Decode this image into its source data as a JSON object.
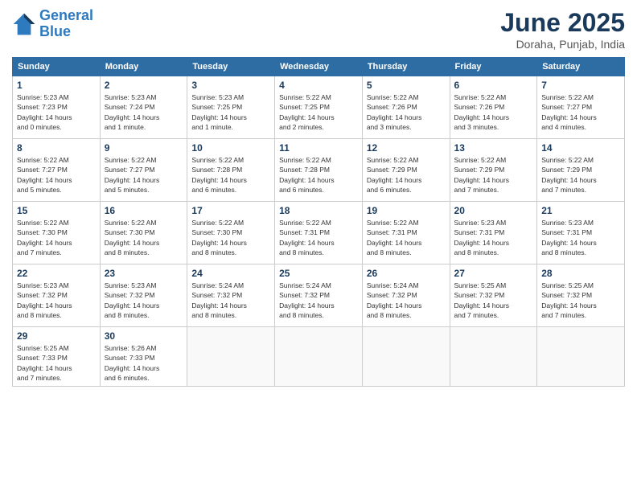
{
  "logo": {
    "line1": "General",
    "line2": "Blue"
  },
  "title": "June 2025",
  "location": "Doraha, Punjab, India",
  "days_header": [
    "Sunday",
    "Monday",
    "Tuesday",
    "Wednesday",
    "Thursday",
    "Friday",
    "Saturday"
  ],
  "weeks": [
    [
      {
        "day": "1",
        "info": "Sunrise: 5:23 AM\nSunset: 7:23 PM\nDaylight: 14 hours\nand 0 minutes."
      },
      {
        "day": "2",
        "info": "Sunrise: 5:23 AM\nSunset: 7:24 PM\nDaylight: 14 hours\nand 1 minute."
      },
      {
        "day": "3",
        "info": "Sunrise: 5:23 AM\nSunset: 7:25 PM\nDaylight: 14 hours\nand 1 minute."
      },
      {
        "day": "4",
        "info": "Sunrise: 5:22 AM\nSunset: 7:25 PM\nDaylight: 14 hours\nand 2 minutes."
      },
      {
        "day": "5",
        "info": "Sunrise: 5:22 AM\nSunset: 7:26 PM\nDaylight: 14 hours\nand 3 minutes."
      },
      {
        "day": "6",
        "info": "Sunrise: 5:22 AM\nSunset: 7:26 PM\nDaylight: 14 hours\nand 3 minutes."
      },
      {
        "day": "7",
        "info": "Sunrise: 5:22 AM\nSunset: 7:27 PM\nDaylight: 14 hours\nand 4 minutes."
      }
    ],
    [
      {
        "day": "8",
        "info": "Sunrise: 5:22 AM\nSunset: 7:27 PM\nDaylight: 14 hours\nand 5 minutes."
      },
      {
        "day": "9",
        "info": "Sunrise: 5:22 AM\nSunset: 7:27 PM\nDaylight: 14 hours\nand 5 minutes."
      },
      {
        "day": "10",
        "info": "Sunrise: 5:22 AM\nSunset: 7:28 PM\nDaylight: 14 hours\nand 6 minutes."
      },
      {
        "day": "11",
        "info": "Sunrise: 5:22 AM\nSunset: 7:28 PM\nDaylight: 14 hours\nand 6 minutes."
      },
      {
        "day": "12",
        "info": "Sunrise: 5:22 AM\nSunset: 7:29 PM\nDaylight: 14 hours\nand 6 minutes."
      },
      {
        "day": "13",
        "info": "Sunrise: 5:22 AM\nSunset: 7:29 PM\nDaylight: 14 hours\nand 7 minutes."
      },
      {
        "day": "14",
        "info": "Sunrise: 5:22 AM\nSunset: 7:29 PM\nDaylight: 14 hours\nand 7 minutes."
      }
    ],
    [
      {
        "day": "15",
        "info": "Sunrise: 5:22 AM\nSunset: 7:30 PM\nDaylight: 14 hours\nand 7 minutes."
      },
      {
        "day": "16",
        "info": "Sunrise: 5:22 AM\nSunset: 7:30 PM\nDaylight: 14 hours\nand 8 minutes."
      },
      {
        "day": "17",
        "info": "Sunrise: 5:22 AM\nSunset: 7:30 PM\nDaylight: 14 hours\nand 8 minutes."
      },
      {
        "day": "18",
        "info": "Sunrise: 5:22 AM\nSunset: 7:31 PM\nDaylight: 14 hours\nand 8 minutes."
      },
      {
        "day": "19",
        "info": "Sunrise: 5:22 AM\nSunset: 7:31 PM\nDaylight: 14 hours\nand 8 minutes."
      },
      {
        "day": "20",
        "info": "Sunrise: 5:23 AM\nSunset: 7:31 PM\nDaylight: 14 hours\nand 8 minutes."
      },
      {
        "day": "21",
        "info": "Sunrise: 5:23 AM\nSunset: 7:31 PM\nDaylight: 14 hours\nand 8 minutes."
      }
    ],
    [
      {
        "day": "22",
        "info": "Sunrise: 5:23 AM\nSunset: 7:32 PM\nDaylight: 14 hours\nand 8 minutes."
      },
      {
        "day": "23",
        "info": "Sunrise: 5:23 AM\nSunset: 7:32 PM\nDaylight: 14 hours\nand 8 minutes."
      },
      {
        "day": "24",
        "info": "Sunrise: 5:24 AM\nSunset: 7:32 PM\nDaylight: 14 hours\nand 8 minutes."
      },
      {
        "day": "25",
        "info": "Sunrise: 5:24 AM\nSunset: 7:32 PM\nDaylight: 14 hours\nand 8 minutes."
      },
      {
        "day": "26",
        "info": "Sunrise: 5:24 AM\nSunset: 7:32 PM\nDaylight: 14 hours\nand 8 minutes."
      },
      {
        "day": "27",
        "info": "Sunrise: 5:25 AM\nSunset: 7:32 PM\nDaylight: 14 hours\nand 7 minutes."
      },
      {
        "day": "28",
        "info": "Sunrise: 5:25 AM\nSunset: 7:32 PM\nDaylight: 14 hours\nand 7 minutes."
      }
    ],
    [
      {
        "day": "29",
        "info": "Sunrise: 5:25 AM\nSunset: 7:33 PM\nDaylight: 14 hours\nand 7 minutes."
      },
      {
        "day": "30",
        "info": "Sunrise: 5:26 AM\nSunset: 7:33 PM\nDaylight: 14 hours\nand 6 minutes."
      },
      {
        "day": "",
        "info": ""
      },
      {
        "day": "",
        "info": ""
      },
      {
        "day": "",
        "info": ""
      },
      {
        "day": "",
        "info": ""
      },
      {
        "day": "",
        "info": ""
      }
    ]
  ]
}
